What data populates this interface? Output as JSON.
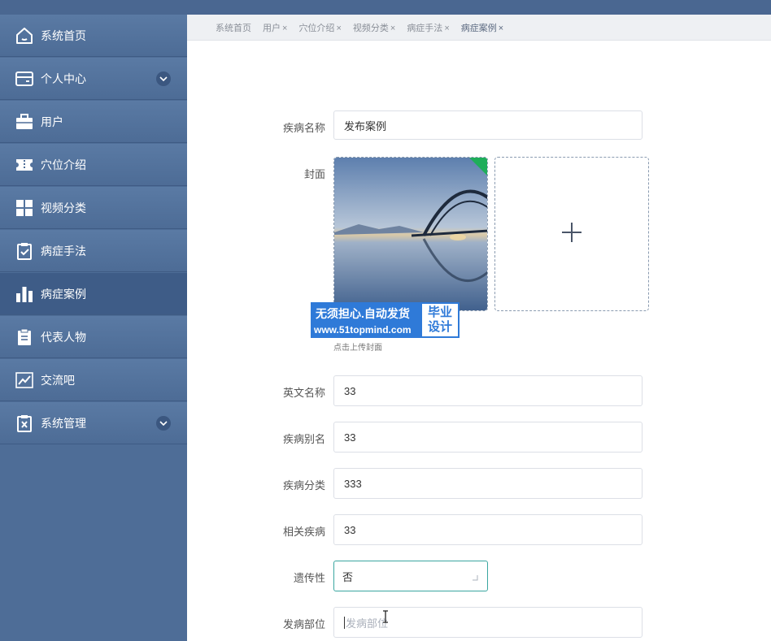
{
  "colors": {
    "sidebar": "#4e6d97",
    "active_item": "#3e5c87",
    "accent": "#3aa6a0",
    "watermark": "#2f7ad8"
  },
  "sidebar": {
    "items": [
      {
        "label": "系统首页",
        "icon": "home-icon"
      },
      {
        "label": "个人中心",
        "icon": "wallet-icon",
        "expandable": true
      },
      {
        "label": "用户",
        "icon": "briefcase-icon"
      },
      {
        "label": "穴位介绍",
        "icon": "ticket-icon"
      },
      {
        "label": "视频分类",
        "icon": "grid-icon"
      },
      {
        "label": "病症手法",
        "icon": "clipboard-check-icon"
      },
      {
        "label": "病症案例",
        "icon": "bar-chart-icon",
        "active": true
      },
      {
        "label": "代表人物",
        "icon": "clipboard-list-icon"
      },
      {
        "label": "交流吧",
        "icon": "line-chart-icon"
      },
      {
        "label": "系统管理",
        "icon": "clipboard-x-icon",
        "expandable": true
      }
    ]
  },
  "tabs": [
    {
      "label": "系统首页",
      "closable": false
    },
    {
      "label": "用户",
      "closable": true
    },
    {
      "label": "穴位介绍",
      "closable": true
    },
    {
      "label": "视频分类",
      "closable": true
    },
    {
      "label": "病症手法",
      "closable": true
    },
    {
      "label": "病症案例",
      "closable": true,
      "active": true
    }
  ],
  "tab_close": "×",
  "form": {
    "disease_name": {
      "label": "疾病名称",
      "value": "发布案例"
    },
    "cover": {
      "label": "封面",
      "hint": "点击上传封面",
      "upload_icon": "plus-icon"
    },
    "english_name": {
      "label": "英文名称",
      "value": "33"
    },
    "alias": {
      "label": "疾病别名",
      "value": "33"
    },
    "category": {
      "label": "疾病分类",
      "value": "333"
    },
    "related": {
      "label": "相关疾病",
      "value": "33"
    },
    "hereditary": {
      "label": "遗传性",
      "value": "否"
    },
    "site": {
      "label": "发病部位",
      "placeholder": "发病部位"
    }
  },
  "watermark": {
    "line1": "无须担心.自动发货",
    "line2": "www.51topmind.com",
    "badge1": "毕业",
    "badge2": "设计"
  }
}
